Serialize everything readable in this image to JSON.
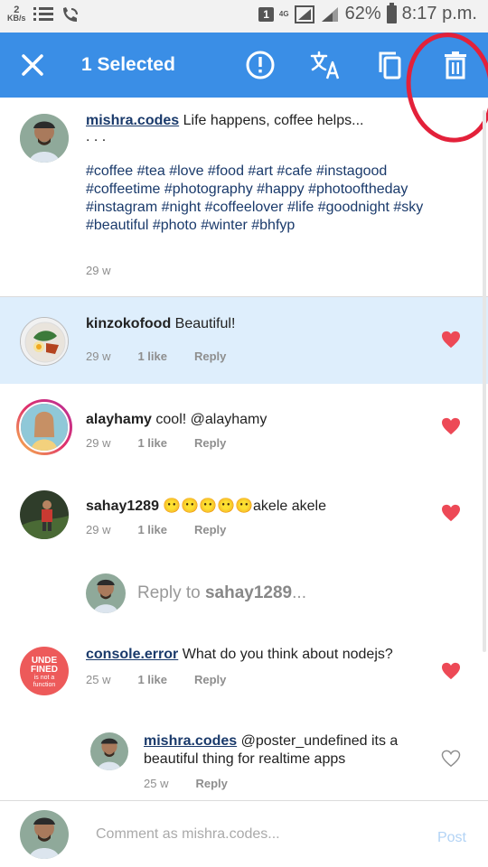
{
  "status_bar": {
    "kbs_value": "2",
    "kbs_unit": "KB/s",
    "sim": "1",
    "network": "4G",
    "battery": "62%",
    "time": "8:17 p.m."
  },
  "toolbar": {
    "title": "1 Selected",
    "close_icon": "close-icon",
    "report_icon": "report-icon",
    "translate_icon": "translate-icon",
    "copy_icon": "copy-icon",
    "delete_icon": "delete-icon"
  },
  "caption": {
    "username": "mishra.codes",
    "text": "Life happens, coffee helps...",
    "ellipsis": ". . .",
    "hashtags": "#coffee #tea #love #food  #art #cafe #instagood #coffeetime #photography  #happy #photooftheday  #instagram #night  #coffeelover #life #goodnight #sky #beautiful #photo #winter #bhfyp",
    "time": "29 w"
  },
  "comments": [
    {
      "username": "kinzokofood",
      "text": "Beautiful!",
      "time": "29 w",
      "likes": "1 like",
      "reply": "Reply",
      "liked": true,
      "selected": true
    },
    {
      "username": "alayhamy",
      "text": "cool! @alayhamy",
      "time": "29 w",
      "likes": "1 like",
      "reply": "Reply",
      "liked": true
    },
    {
      "username": "sahay1289",
      "text": "😶😶😶😶😶akele akele",
      "time": "29 w",
      "likes": "1 like",
      "reply": "Reply",
      "liked": true
    },
    {
      "username": "console.error",
      "text": "What do you think about nodejs?",
      "time": "25 w",
      "likes": "1 like",
      "reply": "Reply",
      "liked": true
    }
  ],
  "reply_prompt": {
    "prefix": "Reply to ",
    "target": "sahay1289",
    "suffix": "..."
  },
  "nested_reply": {
    "username": "mishra.codes",
    "text": "@poster_undefined its a beautiful thing for realtime apps",
    "time": "25 w",
    "reply": "Reply",
    "liked": false
  },
  "console_avatar_text": {
    "line1": "UNDE",
    "line2": "FINED",
    "line3": "is not a",
    "line4": "function"
  },
  "comment_bar": {
    "placeholder": "Comment as mishra.codes...",
    "post": "Post"
  },
  "colors": {
    "toolbar": "#3a8ee6",
    "heart": "#ed4956",
    "selected_row": "#deeefc",
    "annotation": "#e3213a"
  }
}
